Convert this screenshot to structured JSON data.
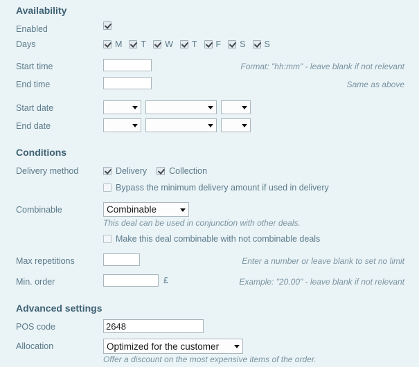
{
  "sections": {
    "availability": {
      "heading": "Availability",
      "enabled": {
        "label": "Enabled",
        "checked": true
      },
      "days": {
        "label": "Days",
        "items": [
          {
            "label": "M",
            "checked": true
          },
          {
            "label": "T",
            "checked": true
          },
          {
            "label": "W",
            "checked": true
          },
          {
            "label": "T",
            "checked": true
          },
          {
            "label": "F",
            "checked": true
          },
          {
            "label": "S",
            "checked": true
          },
          {
            "label": "S",
            "checked": true
          }
        ]
      },
      "start_time": {
        "label": "Start time",
        "value": "",
        "hint": "Format: \"hh:mm\" - leave blank if not relevant"
      },
      "end_time": {
        "label": "End time",
        "value": "",
        "hint": "Same as above"
      },
      "start_date": {
        "label": "Start date",
        "day": "",
        "month": "",
        "year": ""
      },
      "end_date": {
        "label": "End date",
        "day": "",
        "month": "",
        "year": ""
      }
    },
    "conditions": {
      "heading": "Conditions",
      "delivery_method": {
        "label": "Delivery method",
        "options": [
          {
            "label": "Delivery",
            "checked": true
          },
          {
            "label": "Collection",
            "checked": true
          }
        ],
        "bypass": {
          "label": "Bypass the minimum delivery amount if used in delivery",
          "checked": false
        }
      },
      "combinable": {
        "label": "Combinable",
        "value": "Combinable",
        "hint": "This deal can be used in conjunction with other deals.",
        "make_combinable": {
          "label": "Make this deal combinable with not combinable deals",
          "checked": false
        }
      },
      "max_repetitions": {
        "label": "Max repetitions",
        "value": "",
        "hint": "Enter a number or leave blank to set no limit"
      },
      "min_order": {
        "label": "Min. order",
        "value": "",
        "currency": "£",
        "hint": "Example: \"20.00\" - leave blank if not relevant"
      }
    },
    "advanced": {
      "heading": "Advanced settings",
      "pos_code": {
        "label": "POS code",
        "value": "2648"
      },
      "allocation": {
        "label": "Allocation",
        "value": "Optimized for the customer",
        "hint": "Offer a discount on the most expensive items of the order."
      }
    }
  },
  "colors": {
    "background": "#eaf3f6",
    "heading": "#3f6274",
    "label": "#5b7b8a",
    "hint": "#7b95a1",
    "input_border": "#a9b7bd"
  }
}
